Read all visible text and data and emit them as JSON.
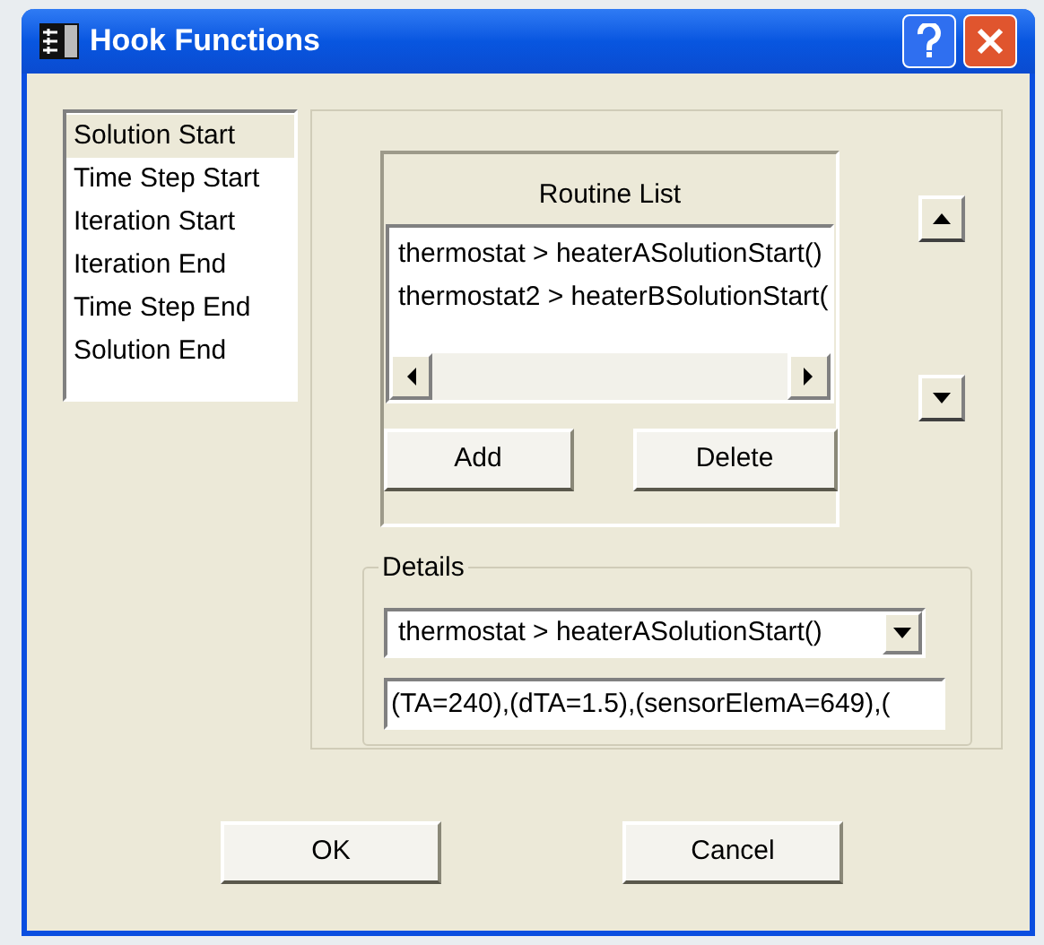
{
  "window": {
    "title": "Hook Functions"
  },
  "events": [
    {
      "label": "Solution Start",
      "selected": true
    },
    {
      "label": "Time Step Start",
      "selected": false
    },
    {
      "label": "Iteration Start",
      "selected": false
    },
    {
      "label": "Iteration End",
      "selected": false
    },
    {
      "label": "Time Step End",
      "selected": false
    },
    {
      "label": "Solution End",
      "selected": false
    }
  ],
  "routine_list": {
    "title": "Routine List",
    "items": [
      {
        "label": "thermostat > heaterASolutionStart()",
        "selected": false
      },
      {
        "label": "thermostat2 > heaterBSolutionStart(",
        "selected": false
      }
    ],
    "buttons": [
      "Add",
      "Delete"
    ]
  },
  "details": {
    "title": "Details",
    "routine": "thermostat > heaterASolutionStart()",
    "parameters": "(TA=240),(dTA=1.5),(sensorElemA=649),("
  },
  "dialog_buttons": [
    "OK",
    "Cancel"
  ]
}
